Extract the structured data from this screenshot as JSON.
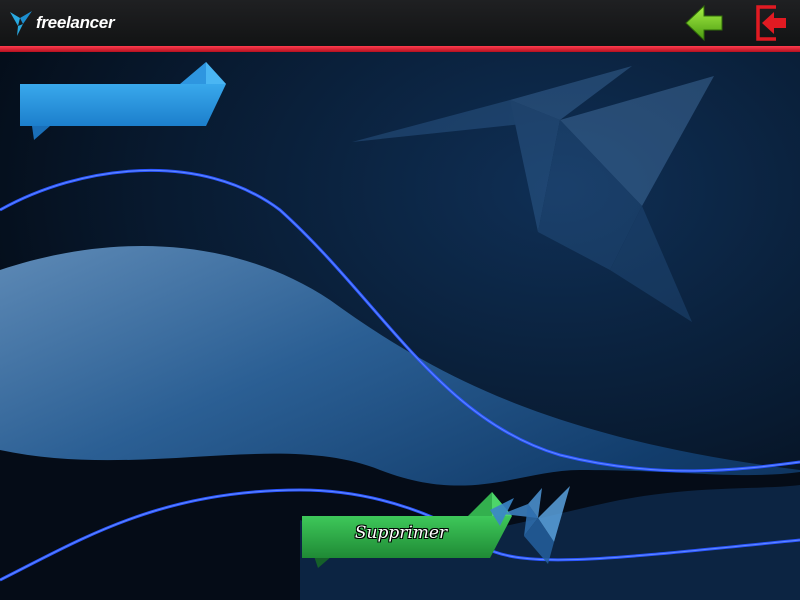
{
  "header": {
    "logo_text": "freelancer",
    "logo_icon": "bird-icon",
    "back_icon": "arrow-left-icon",
    "logout_icon": "logout-icon",
    "colors": {
      "bar": "#1a1b1d",
      "accent_line": "#e0192e",
      "back": "#6cc21c",
      "logout": "#e11a22"
    }
  },
  "banner": {
    "label": ""
  },
  "actions": {
    "delete_label": "Supprimer"
  },
  "colors": {
    "banner_blue": "#2b9de4",
    "button_green": "#2ea043",
    "wave_line": "#2a5bff"
  }
}
